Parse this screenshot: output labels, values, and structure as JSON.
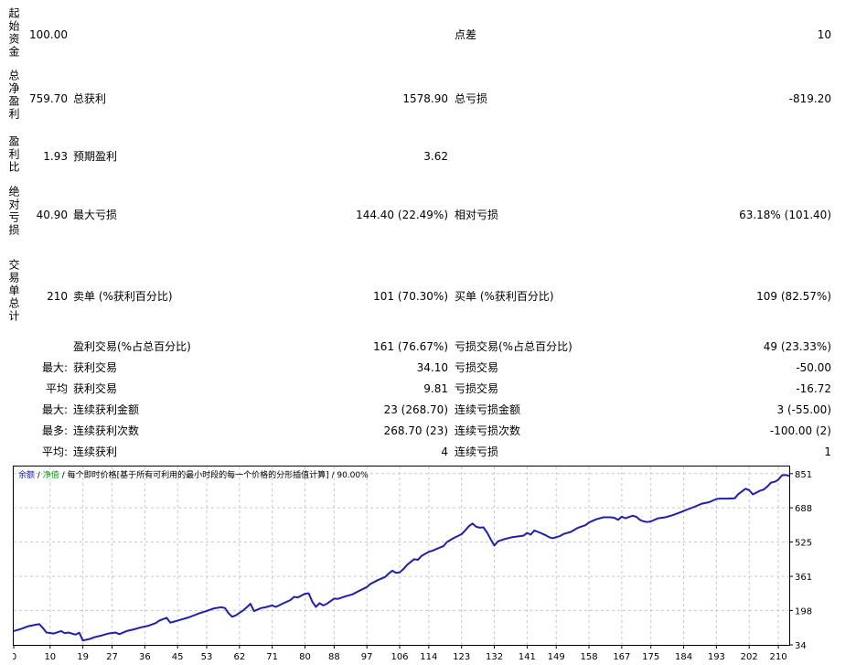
{
  "report": {
    "initial_deposit": {
      "label": "起始资金",
      "value": "100.00"
    },
    "spread": {
      "label": "点差",
      "value": "10"
    },
    "total_net_profit": {
      "label": "总净盈利",
      "value": "759.70"
    },
    "gross_profit": {
      "label": "总获利",
      "value": "1578.90"
    },
    "gross_loss": {
      "label": "总亏损",
      "value": "-819.20"
    },
    "profit_factor": {
      "label": "盈利比",
      "value": "1.93"
    },
    "expected_payoff": {
      "label": "预期盈利",
      "value": "3.62"
    },
    "absolute_drawdown": {
      "label": "绝对亏损",
      "value": "40.90"
    },
    "maximal_drawdown": {
      "label": "最大亏损",
      "value": "144.40 (22.49%)"
    },
    "relative_drawdown": {
      "label": "相对亏损",
      "value": "63.18% (101.40)"
    },
    "total_trades": {
      "label": "交易单总计",
      "value": "210"
    },
    "short_positions": {
      "label": "卖单 (%获利百分比)",
      "value": "101 (70.30%)"
    },
    "long_positions": {
      "label": "买单 (%获利百分比)",
      "value": "109 (82.57%)"
    },
    "profit_trades": {
      "label": "盈利交易(%占总百分比)",
      "value": "161 (76.67%)"
    },
    "loss_trades": {
      "label": "亏损交易(%占总百分比)",
      "value": "49 (23.33%)"
    },
    "largest": {
      "prefix": "最大:",
      "profit_label": "获利交易",
      "profit_value": "34.10",
      "loss_label": "亏损交易",
      "loss_value": "-50.00"
    },
    "average": {
      "prefix": "平均",
      "profit_label": "获利交易",
      "profit_value": "9.81",
      "loss_label": "亏损交易",
      "loss_value": "-16.72"
    },
    "max_consec_amount": {
      "prefix": "最大:",
      "win_label": "连续获利金额",
      "win_value": "23 (268.70)",
      "loss_label": "连续亏损金额",
      "loss_value": "3 (-55.00)"
    },
    "max_consec_count": {
      "prefix": "最多:",
      "win_label": "连续获利次数",
      "win_value": "268.70 (23)",
      "loss_label": "连续亏损次数",
      "loss_value": "-100.00 (2)"
    },
    "average_consec": {
      "prefix": "平均:",
      "win_label": "连续获利",
      "win_value": "4",
      "loss_label": "连续亏损",
      "loss_value": "1"
    }
  },
  "chart_legend": {
    "balance": "余额",
    "sep1": " / ",
    "equity": "净值",
    "sep2": " / ",
    "model": "每个即时价格[基于所有可利用的最小时段的每一个价格的分形插值计算] / 90.00%"
  },
  "colors": {
    "balance": "#1f1fb4",
    "equity": "#11a011",
    "grid": "#c8c8c8",
    "axis": "#000000"
  },
  "chart_data": {
    "type": "line",
    "title": "",
    "xlabel": "",
    "ylabel": "",
    "x_ticks": [
      0,
      10,
      19,
      27,
      36,
      45,
      53,
      62,
      71,
      80,
      88,
      97,
      106,
      114,
      123,
      132,
      141,
      149,
      158,
      167,
      175,
      184,
      193,
      202,
      210
    ],
    "y_ticks": [
      34,
      198,
      361,
      525,
      688,
      851
    ],
    "xlim": [
      0,
      213
    ],
    "ylim": [
      34,
      885
    ],
    "grid": true,
    "series": [
      {
        "values": [
          [
            0,
            100
          ],
          [
            2,
            110
          ],
          [
            4,
            123
          ],
          [
            6,
            130
          ],
          [
            7,
            133
          ],
          [
            8,
            115
          ],
          [
            9,
            93
          ],
          [
            11,
            88
          ],
          [
            13,
            100
          ],
          [
            14,
            90
          ],
          [
            15,
            93
          ],
          [
            17,
            83
          ],
          [
            18,
            92
          ],
          [
            19,
            55
          ],
          [
            21,
            63
          ],
          [
            22,
            70
          ],
          [
            24,
            78
          ],
          [
            26,
            88
          ],
          [
            28,
            93
          ],
          [
            29,
            85
          ],
          [
            31,
            100
          ],
          [
            33,
            108
          ],
          [
            35,
            118
          ],
          [
            37,
            125
          ],
          [
            39,
            138
          ],
          [
            40,
            150
          ],
          [
            42,
            163
          ],
          [
            43,
            140
          ],
          [
            44,
            145
          ],
          [
            46,
            155
          ],
          [
            48,
            165
          ],
          [
            50,
            178
          ],
          [
            51,
            185
          ],
          [
            53,
            196
          ],
          [
            55,
            208
          ],
          [
            57,
            214
          ],
          [
            58,
            210
          ],
          [
            59,
            185
          ],
          [
            60,
            168
          ],
          [
            61,
            175
          ],
          [
            63,
            198
          ],
          [
            64,
            213
          ],
          [
            65,
            230
          ],
          [
            66,
            195
          ],
          [
            68,
            210
          ],
          [
            69,
            213
          ],
          [
            71,
            222
          ],
          [
            72,
            215
          ],
          [
            74,
            232
          ],
          [
            76,
            248
          ],
          [
            77,
            263
          ],
          [
            78,
            260
          ],
          [
            80,
            278
          ],
          [
            81,
            280
          ],
          [
            82,
            240
          ],
          [
            83,
            215
          ],
          [
            84,
            233
          ],
          [
            85,
            222
          ],
          [
            86,
            230
          ],
          [
            88,
            255
          ],
          [
            89,
            253
          ],
          [
            91,
            265
          ],
          [
            93,
            275
          ],
          [
            95,
            293
          ],
          [
            97,
            310
          ],
          [
            98,
            325
          ],
          [
            100,
            343
          ],
          [
            102,
            358
          ],
          [
            103,
            375
          ],
          [
            104,
            388
          ],
          [
            105,
            378
          ],
          [
            106,
            380
          ],
          [
            107,
            395
          ],
          [
            108,
            415
          ],
          [
            110,
            443
          ],
          [
            111,
            440
          ],
          [
            112,
            458
          ],
          [
            114,
            478
          ],
          [
            115,
            483
          ],
          [
            117,
            498
          ],
          [
            118,
            505
          ],
          [
            119,
            525
          ],
          [
            121,
            545
          ],
          [
            123,
            562
          ],
          [
            124,
            580
          ],
          [
            125,
            600
          ],
          [
            126,
            613
          ],
          [
            127,
            598
          ],
          [
            128,
            593
          ],
          [
            129,
            595
          ],
          [
            130,
            570
          ],
          [
            131,
            538
          ],
          [
            132,
            508
          ],
          [
            133,
            528
          ],
          [
            135,
            540
          ],
          [
            137,
            548
          ],
          [
            139,
            553
          ],
          [
            140,
            555
          ],
          [
            141,
            568
          ],
          [
            142,
            560
          ],
          [
            143,
            580
          ],
          [
            144,
            573
          ],
          [
            146,
            558
          ],
          [
            147,
            548
          ],
          [
            148,
            543
          ],
          [
            150,
            553
          ],
          [
            151,
            563
          ],
          [
            153,
            573
          ],
          [
            155,
            593
          ],
          [
            157,
            605
          ],
          [
            158,
            618
          ],
          [
            160,
            633
          ],
          [
            162,
            643
          ],
          [
            164,
            643
          ],
          [
            165,
            640
          ],
          [
            166,
            630
          ],
          [
            167,
            646
          ],
          [
            168,
            638
          ],
          [
            170,
            650
          ],
          [
            171,
            645
          ],
          [
            172,
            630
          ],
          [
            173,
            623
          ],
          [
            174,
            620
          ],
          [
            175,
            623
          ],
          [
            177,
            638
          ],
          [
            179,
            643
          ],
          [
            181,
            653
          ],
          [
            183,
            666
          ],
          [
            185,
            680
          ],
          [
            187,
            693
          ],
          [
            189,
            708
          ],
          [
            191,
            715
          ],
          [
            193,
            730
          ],
          [
            194,
            732
          ],
          [
            196,
            732
          ],
          [
            198,
            733
          ],
          [
            199,
            753
          ],
          [
            200,
            766
          ],
          [
            201,
            779
          ],
          [
            202,
            772
          ],
          [
            203,
            752
          ],
          [
            205,
            770
          ],
          [
            206,
            775
          ],
          [
            207,
            790
          ],
          [
            208,
            808
          ],
          [
            209,
            812
          ],
          [
            210,
            822
          ],
          [
            211,
            843
          ],
          [
            212,
            845
          ],
          [
            213,
            840
          ]
        ]
      }
    ]
  }
}
